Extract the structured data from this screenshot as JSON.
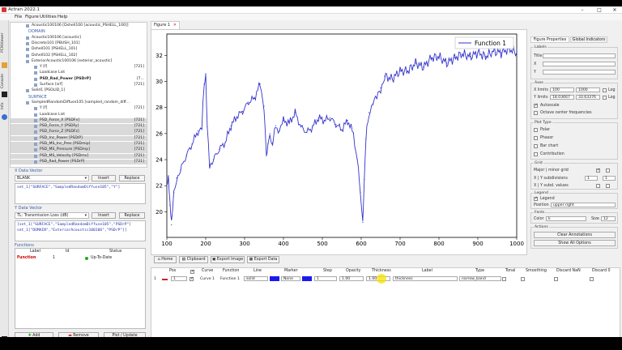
{
  "app": {
    "title": "Actran 2022.1"
  },
  "menu": [
    "File",
    "Figure",
    "Utilities",
    "Help"
  ],
  "side_tabs": [
    "PCNViewer",
    "Console",
    "Info"
  ],
  "tree": [
    {
      "label": "Acoustic100106 [Dshell100 [acoustic_PSHELL_100]]",
      "num": "",
      "indent": 26,
      "style": ""
    },
    {
      "label": "DOMAIN",
      "num": "",
      "indent": 22,
      "style": "sec"
    },
    {
      "label": "Acoustic100106 [acoustic]",
      "num": "",
      "indent": 26,
      "style": ""
    },
    {
      "label": "Discrete101 [PBUSH_101]",
      "num": "",
      "indent": 26,
      "style": ""
    },
    {
      "label": "Dshell101 [PSHELL_101]",
      "num": "",
      "indent": 26,
      "style": ""
    },
    {
      "label": "Dshell102 [PSHELL_102]",
      "num": "",
      "indent": 26,
      "style": ""
    },
    {
      "label": "ExteriorAcoustic100106 [exterior_acoustic]",
      "num": "",
      "indent": 26,
      "style": ""
    },
    {
      "label": "Y [f]",
      "num": "[721]",
      "indent": 36,
      "style": ""
    },
    {
      "label": "Loadcase List",
      "num": "",
      "indent": 36,
      "style": ""
    },
    {
      "label": "PSD_Rad_Power [PSDrP]",
      "num": "[7...",
      "indent": 36,
      "style": "bold"
    },
    {
      "label": "Surface [srf]",
      "num": "[721]",
      "indent": 36,
      "style": ""
    },
    {
      "label": "Solid1 [PSOLID_1]",
      "num": "",
      "indent": 26,
      "style": ""
    },
    {
      "label": "SURFACE",
      "num": "",
      "indent": 22,
      "style": "sec"
    },
    {
      "label": "SampledRandomDiffuse105 [sampled_random_diff...",
      "num": "",
      "indent": 26,
      "style": ""
    },
    {
      "label": "Y [f]",
      "num": "[721]",
      "indent": 36,
      "style": ""
    },
    {
      "label": "Loadcase List",
      "num": "",
      "indent": 36,
      "style": ""
    },
    {
      "label": "PSD_Force_X [PSDFx]",
      "num": "[721]",
      "indent": 36,
      "style": "hl"
    },
    {
      "label": "PSD_Force_Y [PSDFy]",
      "num": "[721]",
      "indent": 36,
      "style": "hl"
    },
    {
      "label": "PSD_Force_Z [PSDFz]",
      "num": "[721]",
      "indent": 36,
      "style": "hl"
    },
    {
      "label": "PSD_Inc_Power [PSDIP]",
      "num": "[721]",
      "indent": 36,
      "style": "hl"
    },
    {
      "label": "PSD_MS_Inc_Pres [PSDmip]",
      "num": "[721]",
      "indent": 36,
      "style": "hl"
    },
    {
      "label": "PSD_MS_Pressure [PSDmp]",
      "num": "[721]",
      "indent": 36,
      "style": "hl"
    },
    {
      "label": "PSD_MS_Velocity [PSDmv]",
      "num": "[721]",
      "indent": 36,
      "style": "hl"
    },
    {
      "label": "PSD_Rad_Power [PSDrP]",
      "num": "[721]",
      "indent": 36,
      "style": "hl"
    }
  ],
  "x_vector": {
    "title": "X Data Vector",
    "select": "BLANK",
    "insert": "Insert",
    "replace": "Replace",
    "code": "set_1[\"SURFACE\",\"SampledRandomDiffuse105\",\"Y\"]"
  },
  "y_vector": {
    "title": "Y Data Vector",
    "select": "TL: Transmission Loss (dB)",
    "insert": "Insert",
    "replace": "Replace",
    "code1": "[set_1[\"SURFACE\",\"SampledRandomDiffuse105\",\"PSDrP\"]",
    "code2": "set_1[\"DOMAIN\",\"ExteriorAcoustic100106\",\"PSDrP\"]]"
  },
  "functions": {
    "title": "Functions",
    "headers": [
      "Label",
      "Id",
      "Status"
    ],
    "row": {
      "label": "Function",
      "id": "1",
      "status": "Up-To-Date"
    },
    "add": "Add",
    "remove": "Remove",
    "plot": "Plot / Update"
  },
  "figure_tab": "Figure 1",
  "toolbar": {
    "home": "Home",
    "clipboard": "Clipboard",
    "export_image": "Export Image",
    "export_data": "Export Data"
  },
  "props": {
    "tabs": [
      "Figure Properties",
      "Global Indicators"
    ],
    "labels_h": "Labels",
    "title_l": "Title",
    "x_l": "X",
    "y_l": "Y",
    "axes_h": "Axes",
    "xlimits_l": "X limits",
    "xmin": "100",
    "xmax": "1000",
    "log_l": "Log",
    "ylimits_l": "Y limits",
    "ymin": "18.03667",
    "ymax": "33.63376",
    "autoscale": "Autoscale",
    "octave": "Octave center frequencies",
    "plottype_h": "Plot Type",
    "polar": "Polar",
    "phasor": "Phasor",
    "barchart": "Bar chart",
    "contribution": "Contribution",
    "grid_h": "Grid",
    "grid_major": "Major | minor grid",
    "xy_sub": "X | Y subdivisions",
    "sub1": "1",
    "sub2": "1",
    "xy_subd_values": "X | Y subd. values",
    "legend_h": "Legend",
    "legend_l": "Legend",
    "position_l": "Position",
    "position_v": "upper right",
    "fonts_h": "Fonts",
    "color_l": "Color",
    "color_v": "k",
    "size_l": "Size",
    "size_v": "12",
    "actions_h": "Actions",
    "clear": "Clear Annotations",
    "showall": "Show All Options"
  },
  "curve_table": {
    "headers": [
      "Pos",
      "",
      "Curve",
      "Function",
      "Line",
      "Marker",
      "Step",
      "Opacity",
      "Thickness",
      "Label",
      "Type",
      "Tonal",
      "Smoothing",
      "Discard NaN",
      "Discard 0"
    ],
    "row": {
      "idx": "1",
      "pos": "1",
      "curve": "Curve 1",
      "function": "Function 1",
      "line": "solid",
      "marker": "None",
      "step": "1",
      "opacity": "1.00",
      "thickness": "1.00",
      "label": "thickness",
      "type": "narrow_band"
    }
  },
  "chart_data": {
    "type": "line",
    "title": "",
    "xlabel": "",
    "ylabel": "",
    "xlim": [
      100,
      1000
    ],
    "ylim": [
      18.03667,
      33.63376
    ],
    "xticks": [
      100,
      200,
      300,
      400,
      500,
      600,
      700,
      800,
      900,
      1000
    ],
    "yticks": [
      20,
      22,
      24,
      26,
      28,
      30,
      32
    ],
    "grid": false,
    "legend_position": "upper right",
    "series": [
      {
        "name": "Function 1",
        "color": "#3333cc",
        "x": [
          100,
          104,
          108,
          112,
          118,
          125,
          135,
          150,
          165,
          180,
          190,
          196,
          200,
          204,
          210,
          220,
          235,
          250,
          265,
          280,
          295,
          310,
          325,
          340,
          350,
          356,
          360,
          365,
          372,
          380,
          390,
          400,
          415,
          430,
          445,
          460,
          475,
          490,
          505,
          520,
          535,
          550,
          565,
          580,
          590,
          598,
          604,
          608,
          612,
          620,
          630,
          640,
          650,
          660,
          680,
          700,
          720,
          740,
          760,
          780,
          800,
          820,
          840,
          860,
          880,
          900,
          920,
          940,
          960,
          980,
          1000
        ],
        "y": [
          21.8,
          22.5,
          20.5,
          19.0,
          21.5,
          22.6,
          23.2,
          24.3,
          25.2,
          26.2,
          26.4,
          29.8,
          30.6,
          26.5,
          23.6,
          24.0,
          24.8,
          25.3,
          26.6,
          27.3,
          27.7,
          28.4,
          28.7,
          29.8,
          28.1,
          24.3,
          25.2,
          26.0,
          25.3,
          26.6,
          26.2,
          27.0,
          26.8,
          27.6,
          26.5,
          26.1,
          26.5,
          27.2,
          27.0,
          27.2,
          26.7,
          26.3,
          27.0,
          26.0,
          24.0,
          21.5,
          19.2,
          22.5,
          25.6,
          27.6,
          28.3,
          28.7,
          29.5,
          30.4,
          30.2,
          30.8,
          30.8,
          31.4,
          31.1,
          31.8,
          31.9,
          31.4,
          31.8,
          32.1,
          31.9,
          32.2,
          31.9,
          32.3,
          32.2,
          32.5,
          32.2
        ]
      }
    ]
  }
}
